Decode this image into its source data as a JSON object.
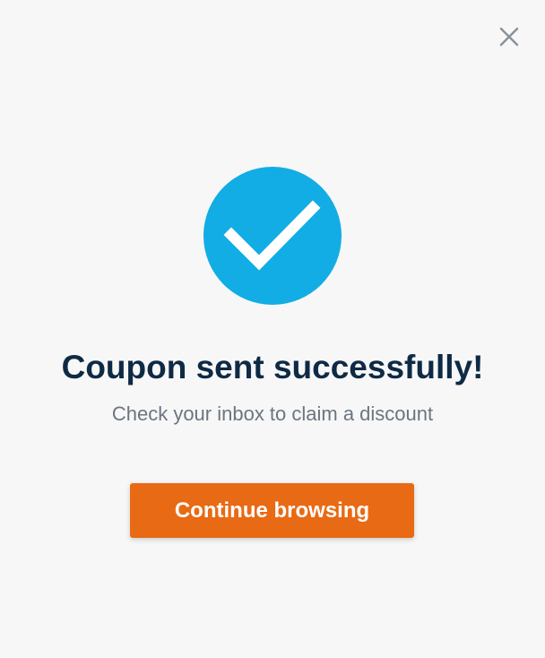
{
  "dialog": {
    "close_icon": "close-icon",
    "status_icon": "checkmark-icon",
    "title": "Coupon sent successfully!",
    "subtitle": "Check your inbox to claim a discount",
    "button_label": "Continue browsing"
  },
  "colors": {
    "accent": "#12ade4",
    "button": "#e96a14",
    "title": "#0e2a45",
    "subtitle": "#6b7580",
    "background": "#f7f7f7"
  }
}
